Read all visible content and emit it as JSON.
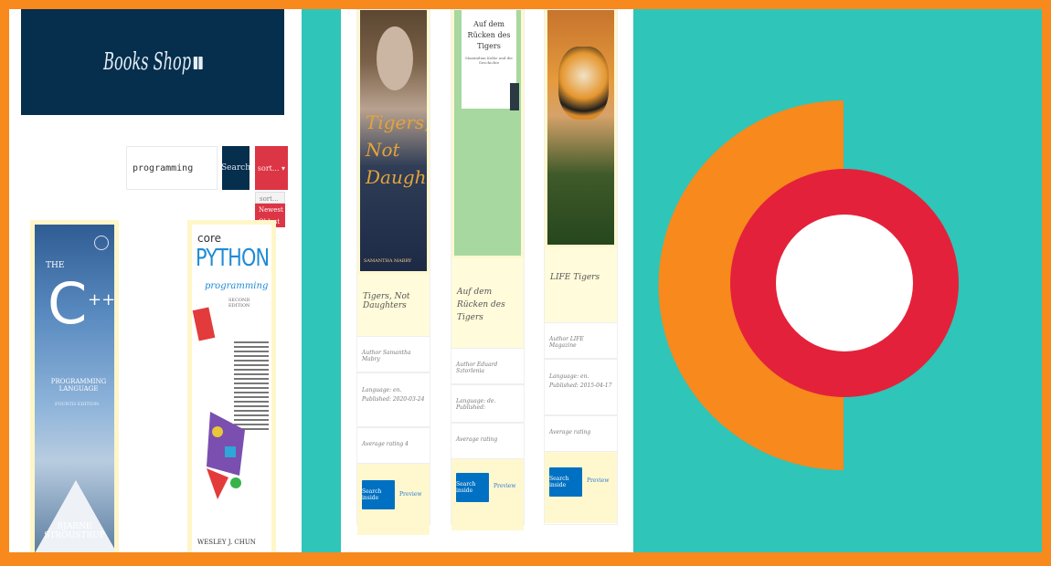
{
  "colors": {
    "frame": "#f7891d",
    "background": "#2fc5b8",
    "header": "#062e4d",
    "sort": "#dc3545",
    "button": "#0071c2",
    "logo_orange": "#f7891d",
    "logo_red": "#e4213a"
  },
  "shop": {
    "title": "Books Shop",
    "icon": "book-icon",
    "search_value": "programming",
    "search_label": "Search",
    "sort_label": "sort... ▾",
    "sort_options": [
      "sort...",
      "Newest",
      "Oldest"
    ]
  },
  "covers": {
    "cpp": {
      "the": "THE",
      "c": "C",
      "pp": "++",
      "subtitle": "PROGRAMMING LANGUAGE",
      "edition": "FOURTH EDITION",
      "author": "BJARNE STROUSTRUP"
    },
    "python": {
      "core": "core",
      "title": "PYTHON",
      "subtitle": "programming",
      "edition": "SECOND EDITION",
      "author": "WESLEY J. CHUN"
    },
    "tigers": {
      "title": "Tigers, Not Daughters",
      "author": "SAMANTHA MABRY"
    },
    "ruecken": {
      "title": "Auf dem Rücken des Tigers",
      "subtitle": "Maximilian Kolbe und die Geschichte"
    }
  },
  "books": [
    {
      "title": "Tigers, Not Daughters",
      "author": "Author Samantha Mabry",
      "lang": "Language: en. Published: 2020-03-24",
      "rating": "Average rating 4",
      "search": "Search inside",
      "preview": "Preview"
    },
    {
      "title": "Auf dem Rücken des Tigers",
      "author": "Author Eduard Sztorlenia",
      "lang": "Language: de. Published:",
      "rating": "Average rating",
      "search": "Search inside",
      "preview": "Preview"
    },
    {
      "title": "LIFE Tigers",
      "author": "Author LIFE Magazine",
      "lang": "Language: en. Published: 2015-04-17",
      "rating": "Average rating",
      "search": "Search inside",
      "preview": "Preview"
    }
  ]
}
